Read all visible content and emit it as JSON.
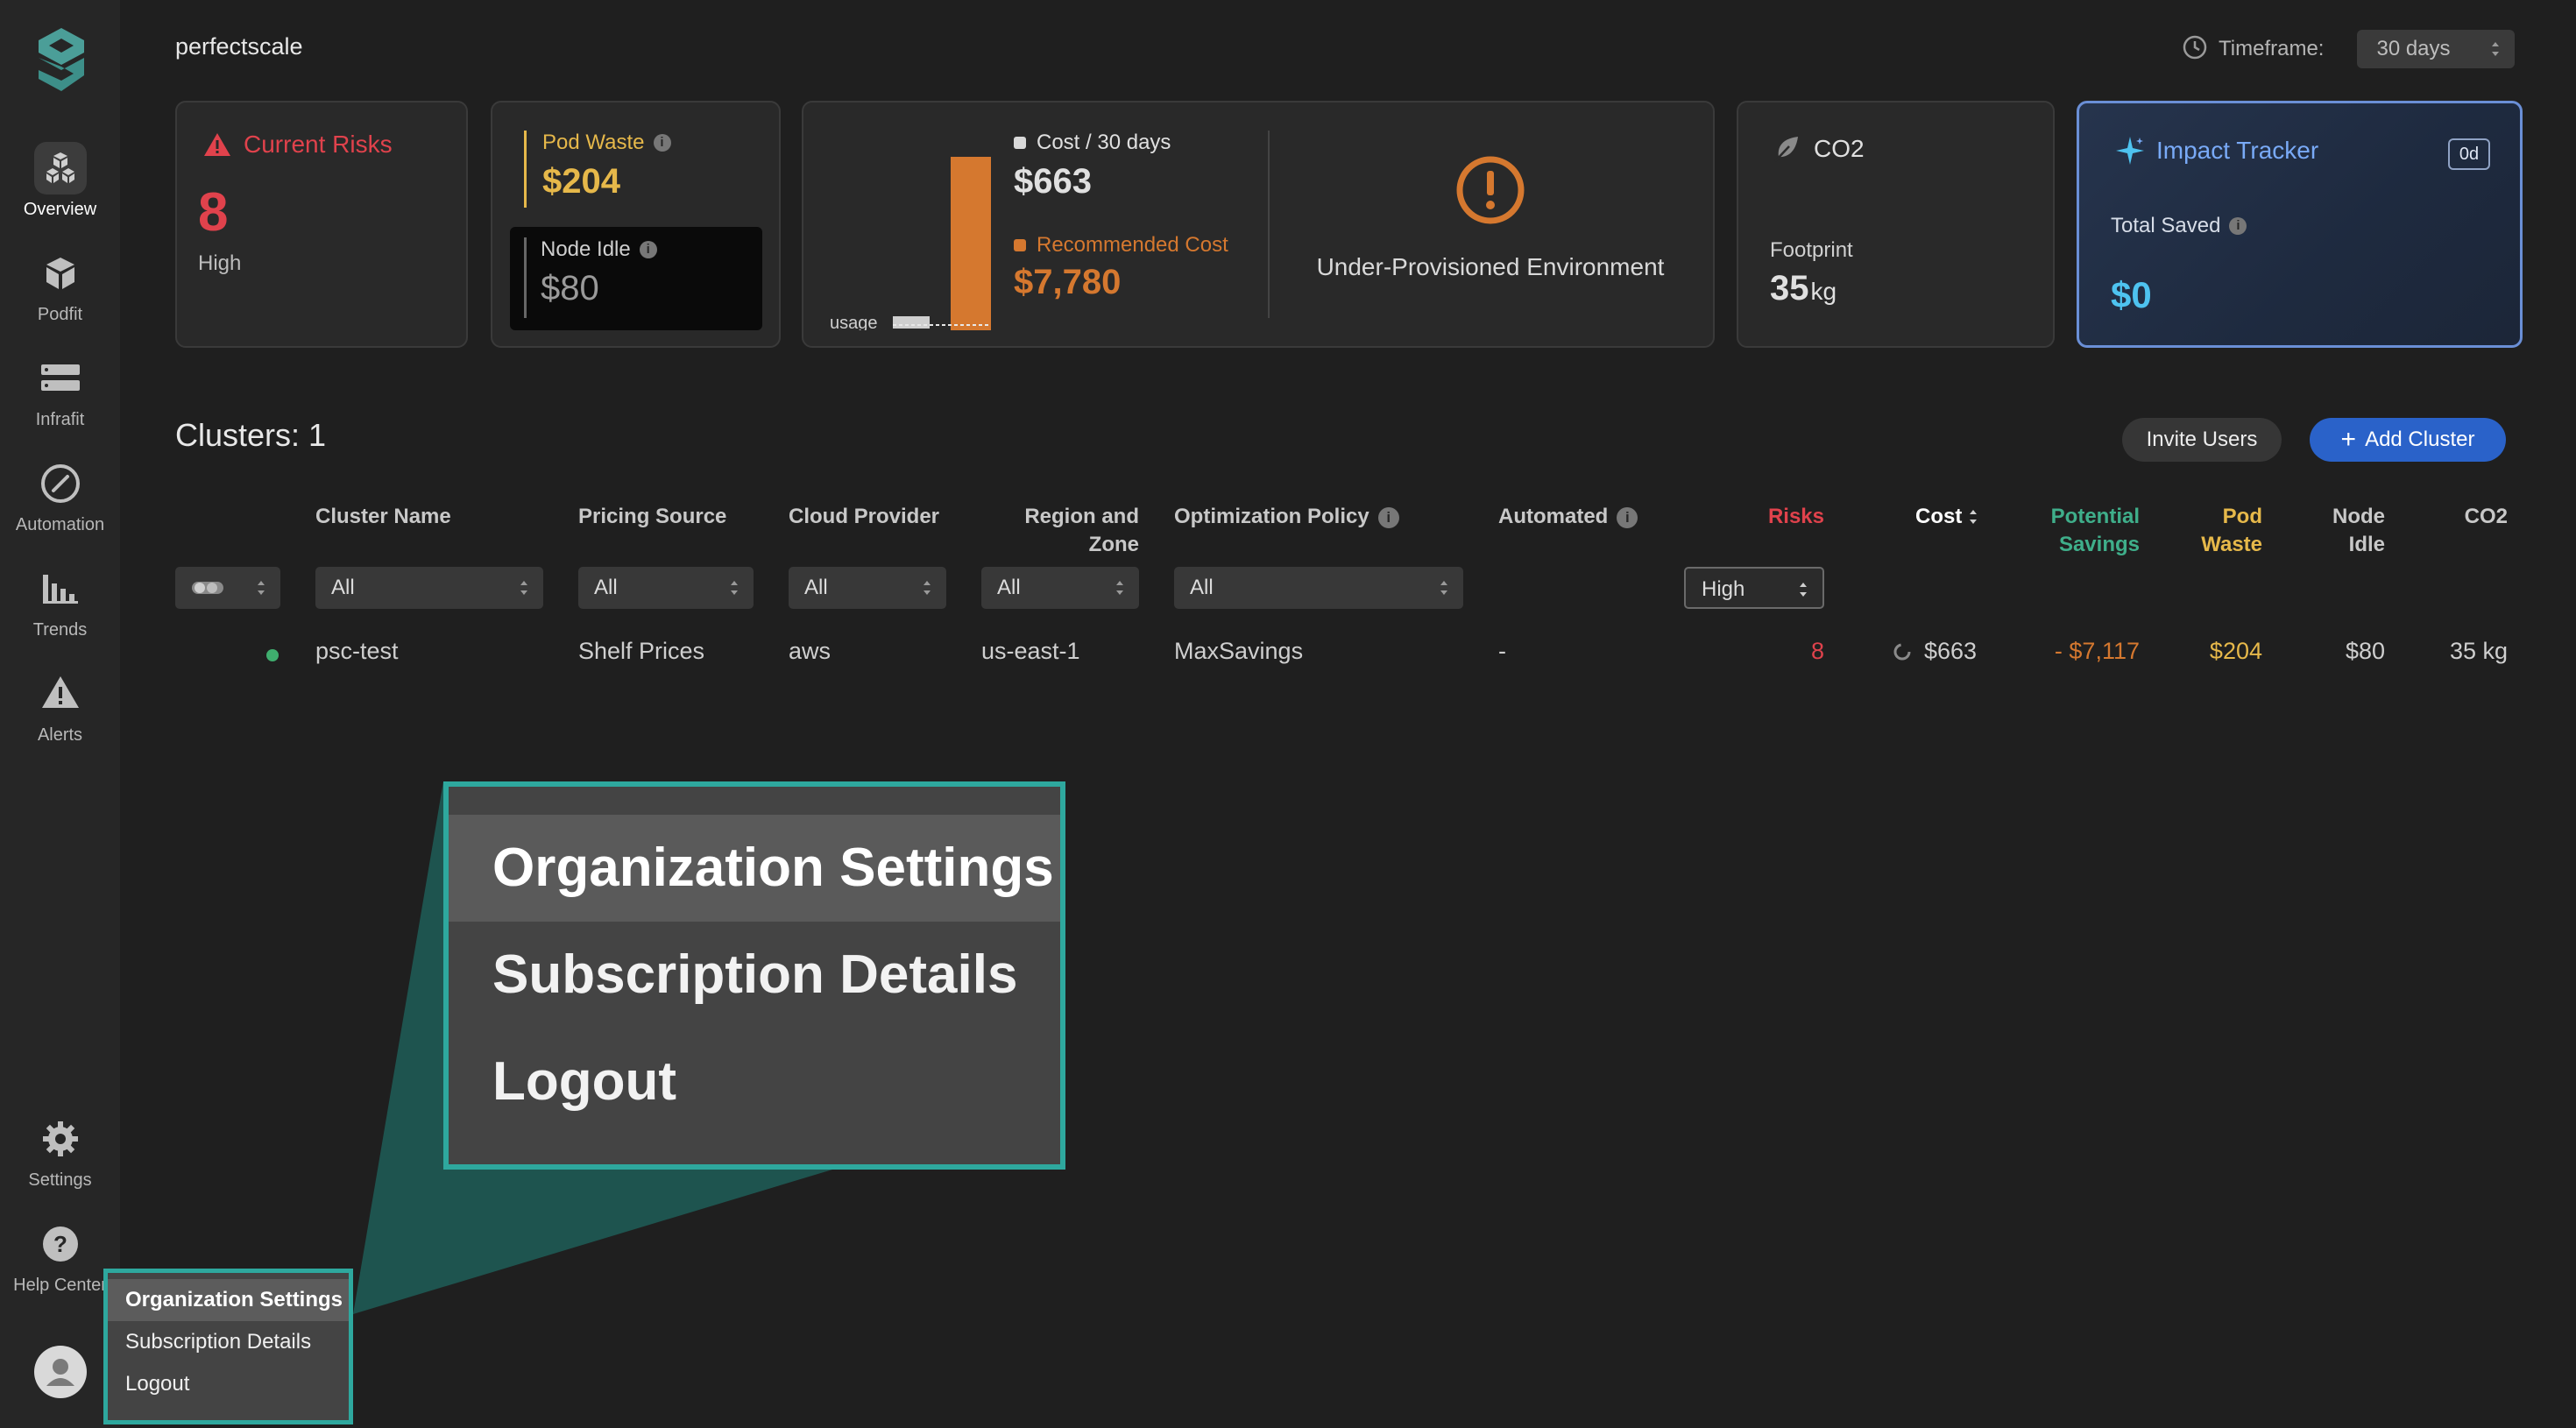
{
  "sidebar": {
    "items": [
      {
        "label": "Overview",
        "icon": "cubes-icon",
        "active": true
      },
      {
        "label": "Podfit",
        "icon": "cube-icon"
      },
      {
        "label": "Infrafit",
        "icon": "server-icon"
      },
      {
        "label": "Automation",
        "icon": "compass-icon"
      },
      {
        "label": "Trends",
        "icon": "bar-chart-icon"
      },
      {
        "label": "Alerts",
        "icon": "warning-icon"
      }
    ],
    "bottom": [
      {
        "label": "Settings",
        "icon": "gear-icon"
      },
      {
        "label": "Help Center",
        "icon": "help-icon"
      }
    ]
  },
  "header": {
    "org_name": "perfectscale",
    "timeframe_label": "Timeframe:",
    "timeframe_value": "30 days"
  },
  "cards": {
    "risks": {
      "title": "Current Risks",
      "value": "8",
      "level": "High"
    },
    "pod_waste": {
      "label": "Pod Waste",
      "value": "$204"
    },
    "node_idle": {
      "label": "Node Idle",
      "value": "$80"
    },
    "cost": {
      "usage_label": "usage",
      "cost_label": "Cost / 30 days",
      "cost_value": "$663",
      "recommended_label": "Recommended Cost",
      "recommended_value": "$7,780",
      "environment_status": "Under-Provisioned Environment"
    },
    "co2": {
      "title": "CO2",
      "label": "Footprint",
      "value": "35",
      "unit": "kg"
    },
    "impact": {
      "title": "Impact Tracker",
      "badge": "0d",
      "label": "Total Saved",
      "value": "$0"
    }
  },
  "clusters": {
    "title": "Clusters: 1",
    "invite_label": "Invite Users",
    "add_label": "Add Cluster",
    "columns": {
      "cluster_name": "Cluster Name",
      "pricing_source": "Pricing Source",
      "cloud_provider": "Cloud Provider",
      "region_line1": "Region and",
      "region_line2": "Zone",
      "optimization_policy": "Optimization Policy",
      "automated": "Automated",
      "risks": "Risks",
      "cost": "Cost",
      "savings_line1": "Potential",
      "savings_line2": "Savings",
      "pod_waste_line1": "Pod",
      "pod_waste_line2": "Waste",
      "node_idle_line1": "Node",
      "node_idle_line2": "Idle",
      "co2": "CO2"
    },
    "filters": {
      "cluster_name": "All",
      "pricing_source": "All",
      "cloud_provider": "All",
      "region": "All",
      "optimization_policy": "All",
      "risks": "High"
    },
    "rows": [
      {
        "name": "psc-test",
        "pricing_source": "Shelf Prices",
        "cloud_provider": "aws",
        "region": "us-east-1",
        "optimization_policy": "MaxSavings",
        "automated": "-",
        "risks": "8",
        "cost": "$663",
        "potential_savings": "- $7,117",
        "pod_waste": "$204",
        "node_idle": "$80",
        "co2": "35 kg"
      }
    ]
  },
  "user_menu": {
    "items": [
      "Organization Settings",
      "Subscription Details",
      "Logout"
    ],
    "highlighted": "Organization Settings"
  },
  "colors": {
    "risk": "#e0424c",
    "waste": "#e6b84a",
    "recommended": "#d5782f",
    "savings": "#3fae8a",
    "accent": "#2ea89e",
    "primary_button": "#2a62c9",
    "impact": "#79aaf7"
  }
}
